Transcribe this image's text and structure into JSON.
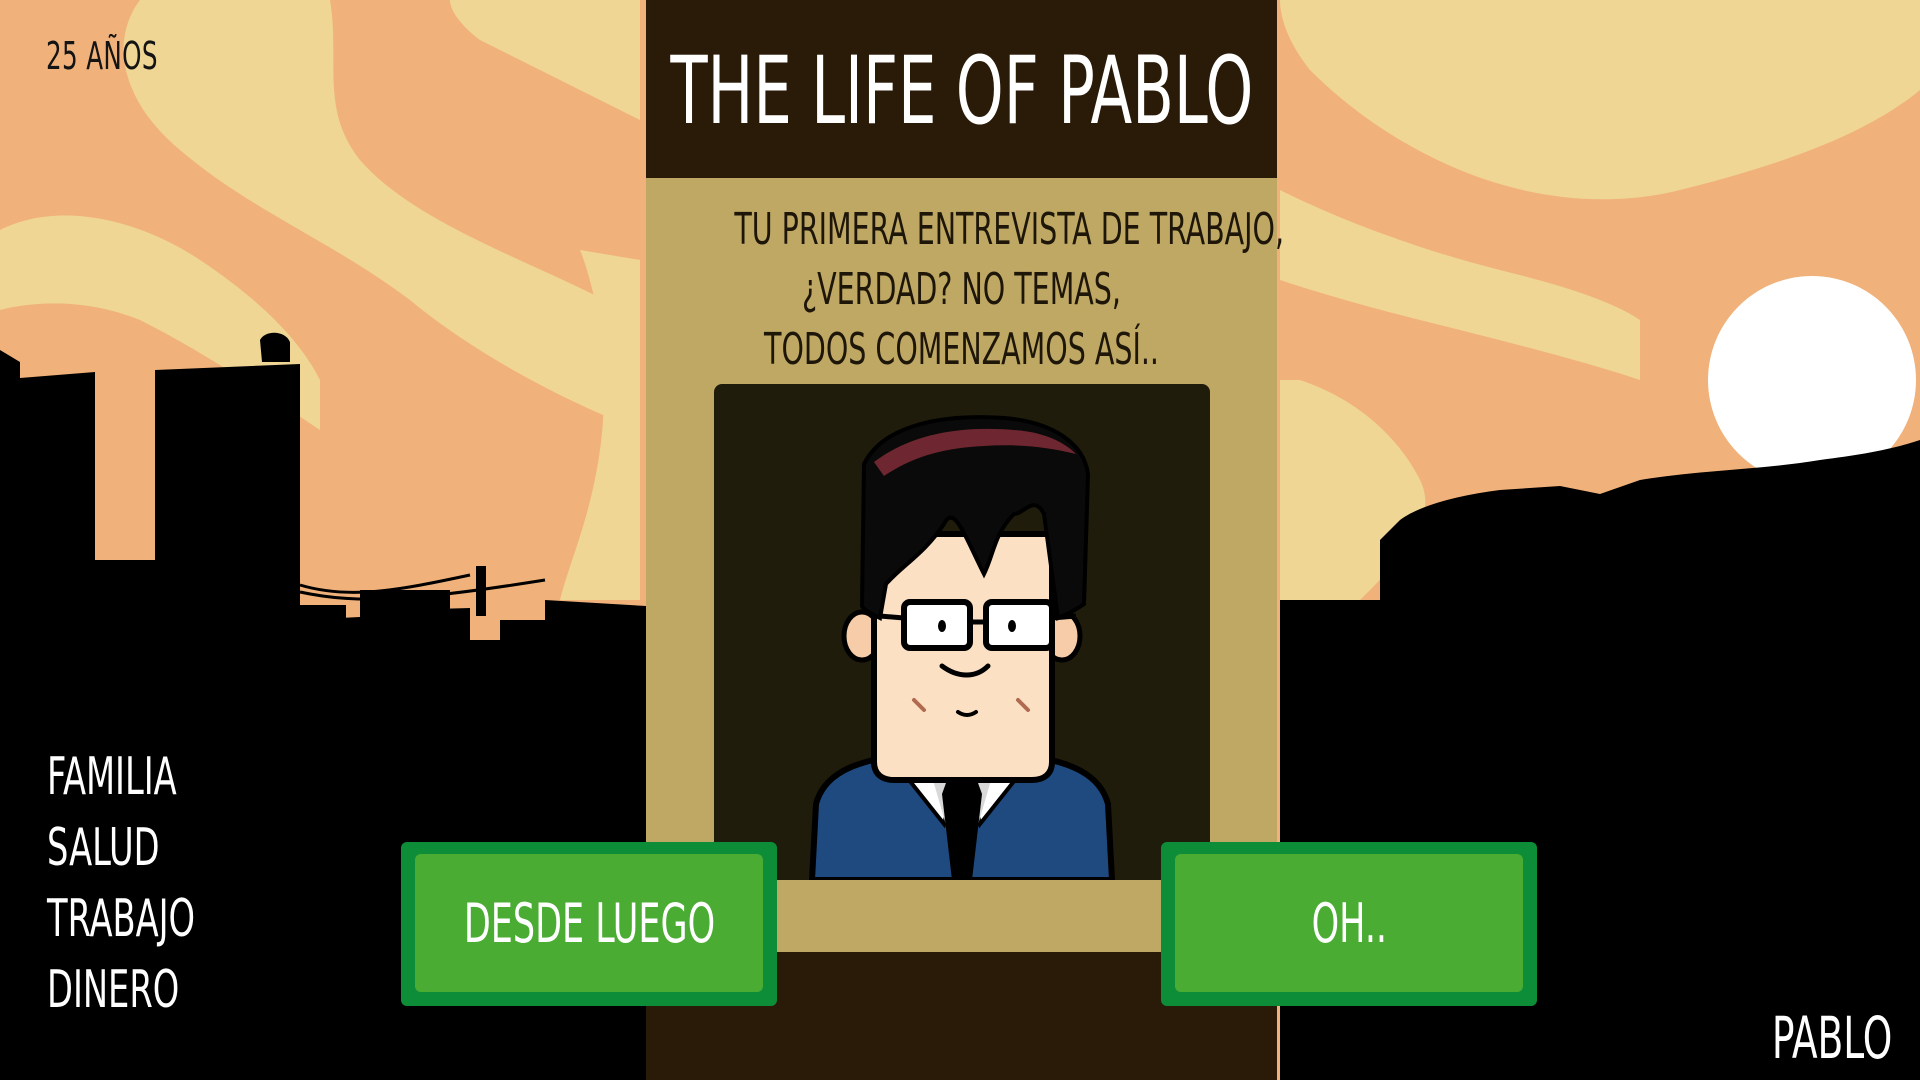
{
  "hud": {
    "age": "25 AÑOS",
    "player_name": "PABLO"
  },
  "stats": [
    {
      "label": "FAMILIA"
    },
    {
      "label": "SALUD"
    },
    {
      "label": "TRABAJO"
    },
    {
      "label": "DINERO"
    }
  ],
  "card": {
    "title": "THE LIFE OF PABLO",
    "dialog_lines": [
      "TU PRIMERA ENTREVISTA DE TRABAJO,",
      "¿VERDAD? NO TEMAS,",
      "TODOS COMENZAMOS ASÍ.."
    ],
    "character_icon": "interviewer-portrait"
  },
  "choices": {
    "left": {
      "label": "DESDE LUEGO"
    },
    "right": {
      "label": "OH.."
    }
  },
  "colors": {
    "sky": "#f0b27a",
    "sky_light": "#efd694",
    "silhouette": "#000000",
    "card": "#bea864",
    "card_header": "#2a1a08",
    "button": "#4aac33",
    "button_border": "#0e8d38"
  }
}
